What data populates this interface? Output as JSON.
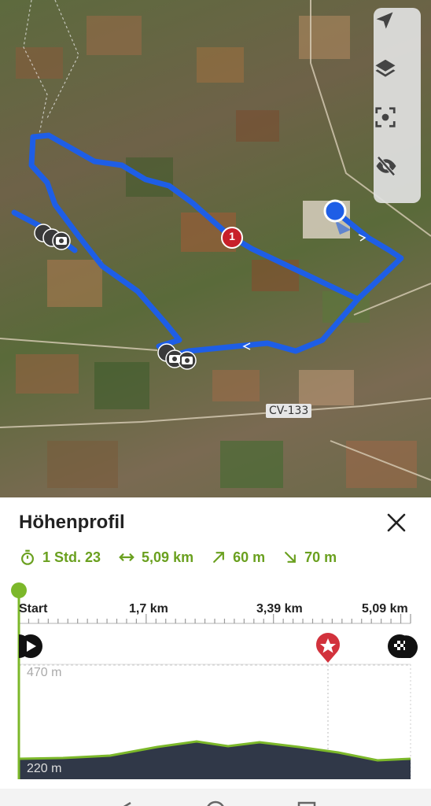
{
  "map": {
    "road_label": "CV-133",
    "waypoint_number": "1",
    "controls": [
      "locate-icon",
      "layers-icon",
      "focus-icon",
      "hide-icon"
    ]
  },
  "sheet": {
    "title": "Höhenprofil",
    "stats": {
      "duration": "1 Std. 23",
      "distance": "5,09 km",
      "ascent": "60 m",
      "descent": "70 m"
    },
    "axis": {
      "start": "Start",
      "km1": "1,7 km",
      "km2": "3,39 km",
      "km3": "5,09 km"
    },
    "elevation": {
      "max_label": "470 m",
      "min_label": "220 m"
    }
  },
  "colors": {
    "accent_green": "#6aa01f",
    "route_blue": "#1e5ee6",
    "waypoint_red": "#c8202a"
  }
}
